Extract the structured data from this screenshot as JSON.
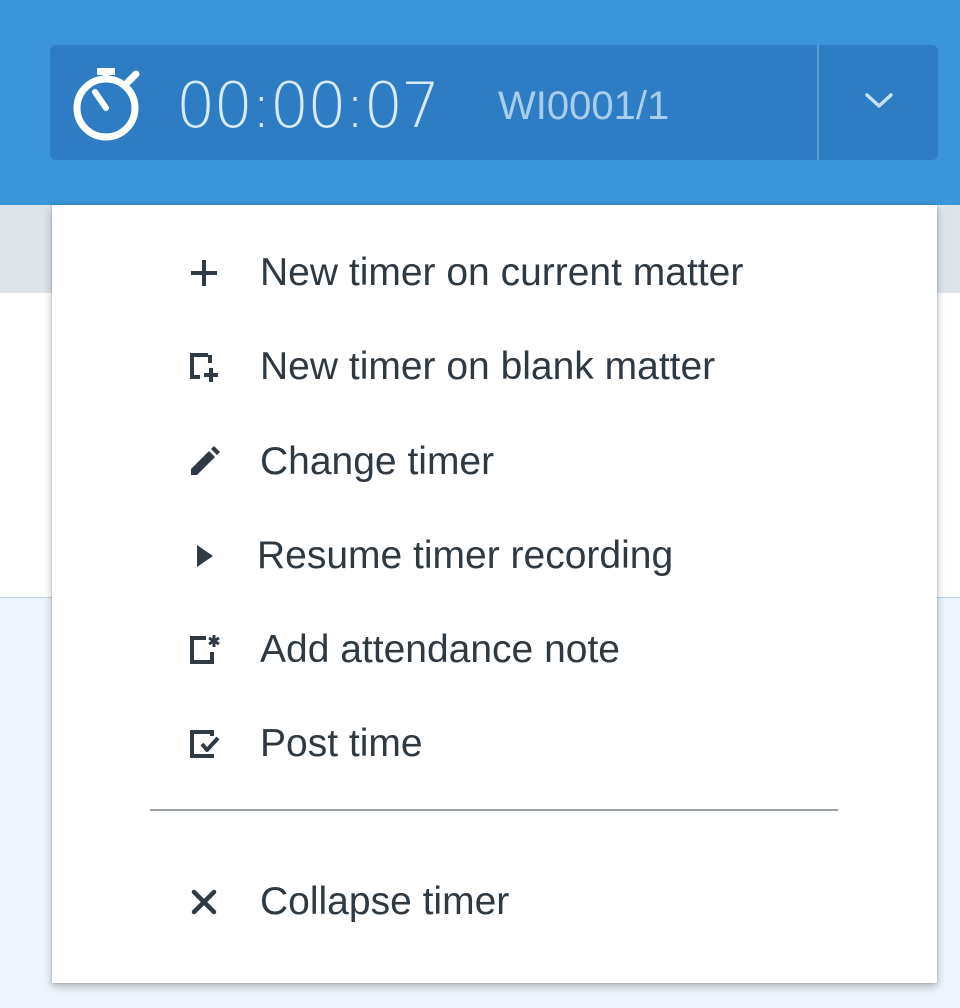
{
  "timer": {
    "time": "00:00:07",
    "matter": "WI0001/1",
    "icon": "stopwatch-icon",
    "toggle_icon": "chevron-down-icon"
  },
  "menu": {
    "items": [
      {
        "label": "New timer on current matter",
        "icon": "plus-icon"
      },
      {
        "label": "New timer on blank matter",
        "icon": "new-blank-matter-icon"
      },
      {
        "label": "Change timer",
        "icon": "pencil-icon"
      },
      {
        "label": "Resume timer recording",
        "icon": "play-icon"
      },
      {
        "label": "Add attendance note",
        "icon": "attendance-note-icon"
      },
      {
        "label": "Post time",
        "icon": "post-time-icon"
      }
    ],
    "footer_items": [
      {
        "label": "Collapse timer",
        "icon": "close-icon"
      }
    ]
  },
  "colors": {
    "topbar": "#3a96d8",
    "timer_background": "#2e7dc4",
    "timer_text": "#d7eaf8",
    "menu_text": "#2f3942",
    "icon": "#2f3a45"
  }
}
